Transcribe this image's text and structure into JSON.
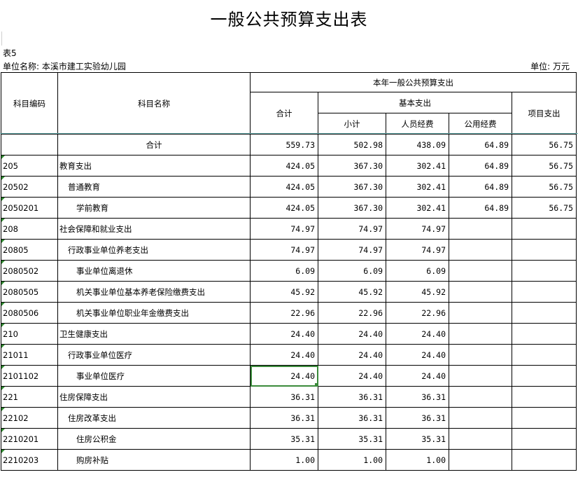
{
  "title": "一般公共预算支出表",
  "table_no": "表5",
  "unit_name": "单位名称: 本溪市建工实验幼儿园",
  "unit": "单位: 万元",
  "headers": {
    "code": "科目编码",
    "name": "科目名称",
    "group": "本年一般公共预算支出",
    "total": "合计",
    "basic": "基本支出",
    "subtotal": "小计",
    "personnel": "人员经费",
    "public": "公用经费",
    "project": "项目支出"
  },
  "rows": [
    {
      "code": "",
      "name": "合计",
      "level": "total",
      "total": "559.73",
      "subtotal": "502.98",
      "personnel": "438.09",
      "public": "64.89",
      "project": "56.75"
    },
    {
      "code": "205",
      "name": "教育支出",
      "level": 0,
      "total": "424.05",
      "subtotal": "367.30",
      "personnel": "302.41",
      "public": "64.89",
      "project": "56.75"
    },
    {
      "code": "20502",
      "name": "普通教育",
      "level": 1,
      "total": "424.05",
      "subtotal": "367.30",
      "personnel": "302.41",
      "public": "64.89",
      "project": "56.75"
    },
    {
      "code": "2050201",
      "name": "学前教育",
      "level": 2,
      "total": "424.05",
      "subtotal": "367.30",
      "personnel": "302.41",
      "public": "64.89",
      "project": "56.75"
    },
    {
      "code": "208",
      "name": "社会保障和就业支出",
      "level": 0,
      "total": "74.97",
      "subtotal": "74.97",
      "personnel": "74.97",
      "public": "",
      "project": ""
    },
    {
      "code": "20805",
      "name": "行政事业单位养老支出",
      "level": 1,
      "total": "74.97",
      "subtotal": "74.97",
      "personnel": "74.97",
      "public": "",
      "project": ""
    },
    {
      "code": "2080502",
      "name": "事业单位离退休",
      "level": 2,
      "total": "6.09",
      "subtotal": "6.09",
      "personnel": "6.09",
      "public": "",
      "project": ""
    },
    {
      "code": "2080505",
      "name": "机关事业单位基本养老保险缴费支出",
      "level": 2,
      "total": "45.92",
      "subtotal": "45.92",
      "personnel": "45.92",
      "public": "",
      "project": ""
    },
    {
      "code": "2080506",
      "name": "机关事业单位职业年金缴费支出",
      "level": 2,
      "total": "22.96",
      "subtotal": "22.96",
      "personnel": "22.96",
      "public": "",
      "project": ""
    },
    {
      "code": "210",
      "name": "卫生健康支出",
      "level": 0,
      "total": "24.40",
      "subtotal": "24.40",
      "personnel": "24.40",
      "public": "",
      "project": ""
    },
    {
      "code": "21011",
      "name": "行政事业单位医疗",
      "level": 1,
      "total": "24.40",
      "subtotal": "24.40",
      "personnel": "24.40",
      "public": "",
      "project": ""
    },
    {
      "code": "2101102",
      "name": "事业单位医疗",
      "level": 2,
      "total": "24.40",
      "subtotal": "24.40",
      "personnel": "24.40",
      "public": "",
      "project": "",
      "selected": true
    },
    {
      "code": "221",
      "name": "住房保障支出",
      "level": 0,
      "total": "36.31",
      "subtotal": "36.31",
      "personnel": "36.31",
      "public": "",
      "project": ""
    },
    {
      "code": "22102",
      "name": "住房改革支出",
      "level": 1,
      "total": "36.31",
      "subtotal": "36.31",
      "personnel": "36.31",
      "public": "",
      "project": ""
    },
    {
      "code": "2210201",
      "name": "住房公积金",
      "level": 2,
      "total": "35.31",
      "subtotal": "35.31",
      "personnel": "35.31",
      "public": "",
      "project": ""
    },
    {
      "code": "2210203",
      "name": "购房补贴",
      "level": 2,
      "total": "1.00",
      "subtotal": "1.00",
      "personnel": "1.00",
      "public": "",
      "project": ""
    }
  ]
}
